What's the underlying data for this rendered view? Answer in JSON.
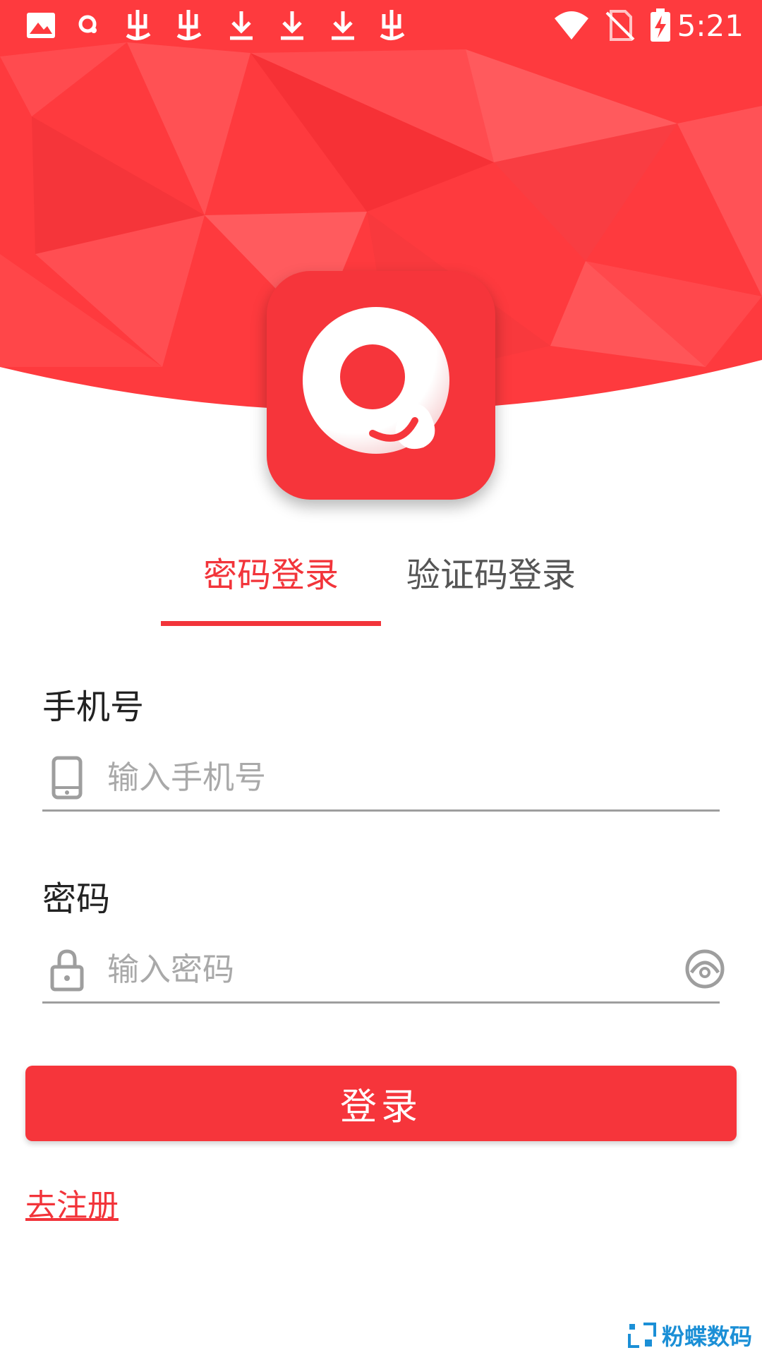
{
  "status_bar": {
    "time": "5:21",
    "left_icons": [
      "image-icon",
      "app-q-icon",
      "bug-icon",
      "bug-icon",
      "download-icon",
      "download-icon",
      "download-icon",
      "bug-icon"
    ],
    "right_icons": [
      "wifi-icon",
      "no-sim-icon",
      "battery-charging-icon"
    ]
  },
  "colors": {
    "brand_red": "#f6353b",
    "header_red": "#fe3a3e"
  },
  "tabs": {
    "password_login": "密码登录",
    "code_login": "验证码登录"
  },
  "phone": {
    "label": "手机号",
    "placeholder": "输入手机号",
    "icon": "phone-icon"
  },
  "password": {
    "label": "密码",
    "placeholder": "输入密码",
    "icon": "lock-icon",
    "toggle_icon": "eye-closed-icon"
  },
  "login_button": "登录",
  "register_link": "去注册",
  "watermark": {
    "text": "粉蝶数码"
  }
}
